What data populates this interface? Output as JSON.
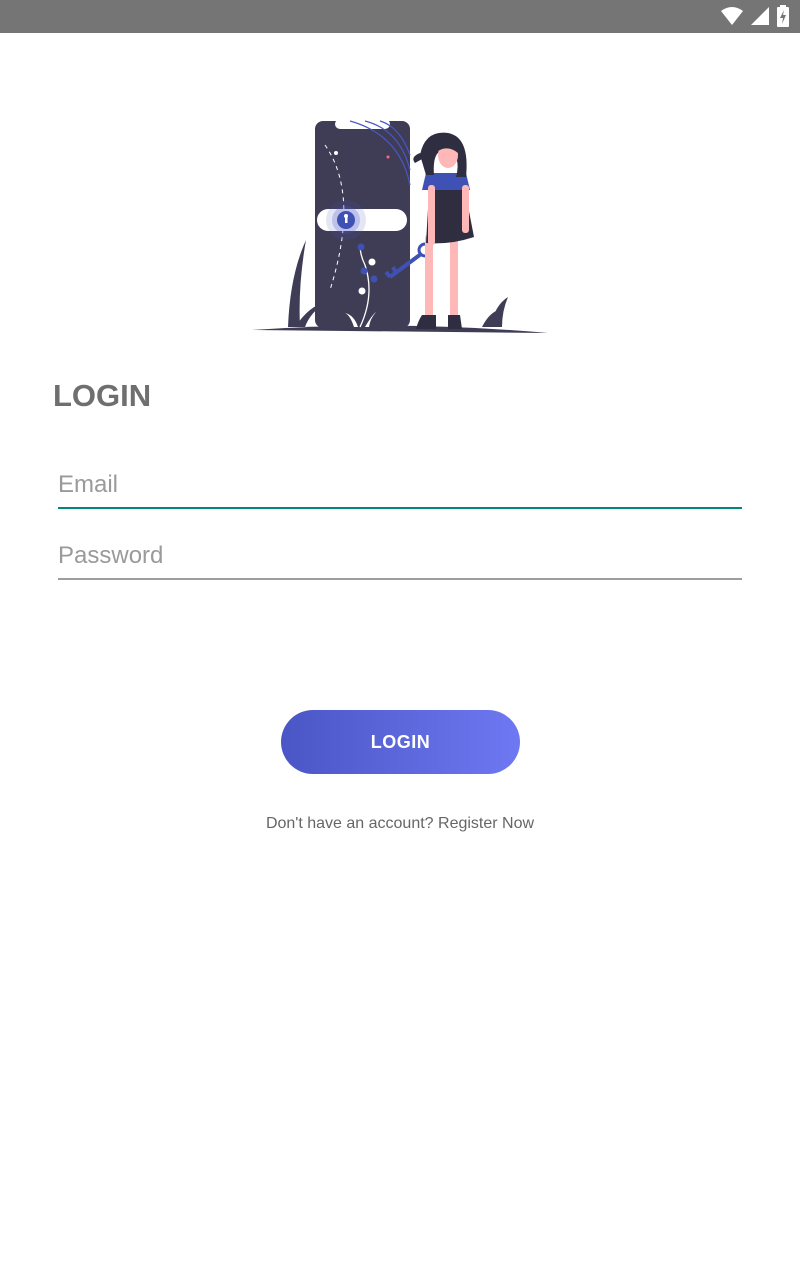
{
  "status_bar": {
    "icons": [
      "wifi-icon",
      "cell-signal-icon",
      "battery-charging-icon"
    ],
    "background": "#757575"
  },
  "illustration": {
    "icon": "girl-with-key-and-phone-lock-illustration"
  },
  "page_title": "LOGIN",
  "email": {
    "placeholder": "Email",
    "value": "",
    "underline_color": "#00897b"
  },
  "password": {
    "placeholder": "Password",
    "value": "",
    "underline_color": "#9e9e9e"
  },
  "login_button": {
    "label": "LOGIN",
    "gradient_start": "#4a56c5",
    "gradient_end": "#6e78f2"
  },
  "register": {
    "text": "Don't have an account? Register Now"
  }
}
